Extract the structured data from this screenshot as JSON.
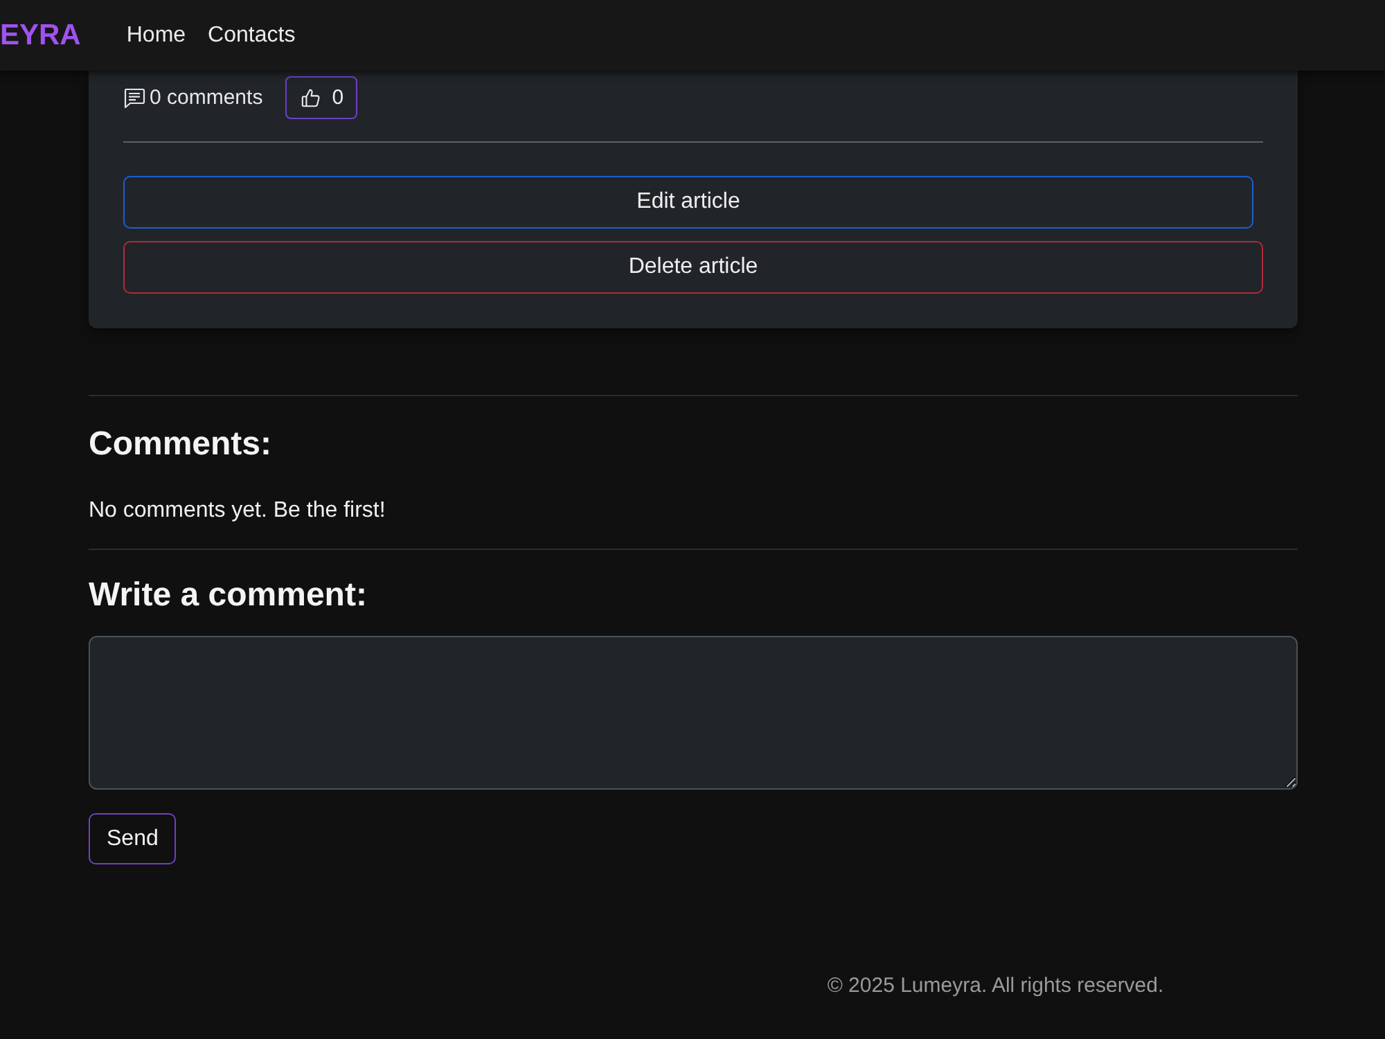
{
  "navbar": {
    "brand": "EYRA",
    "links": [
      {
        "label": "Home"
      },
      {
        "label": "Contacts"
      }
    ]
  },
  "article": {
    "comment_count": "0 comments",
    "likes": "0",
    "buttons": [
      {
        "label": "Edit article",
        "kind": "edit"
      },
      {
        "label": "Delete article",
        "kind": "delete"
      }
    ]
  },
  "comments": {
    "title": "Comments:",
    "empty_message": "No comments yet. Be the first!"
  },
  "comment_form": {
    "title": "Write a comment:",
    "submit": "Send"
  },
  "footer": {
    "text": "© 2025 Lumeyra. All rights reserved."
  }
}
